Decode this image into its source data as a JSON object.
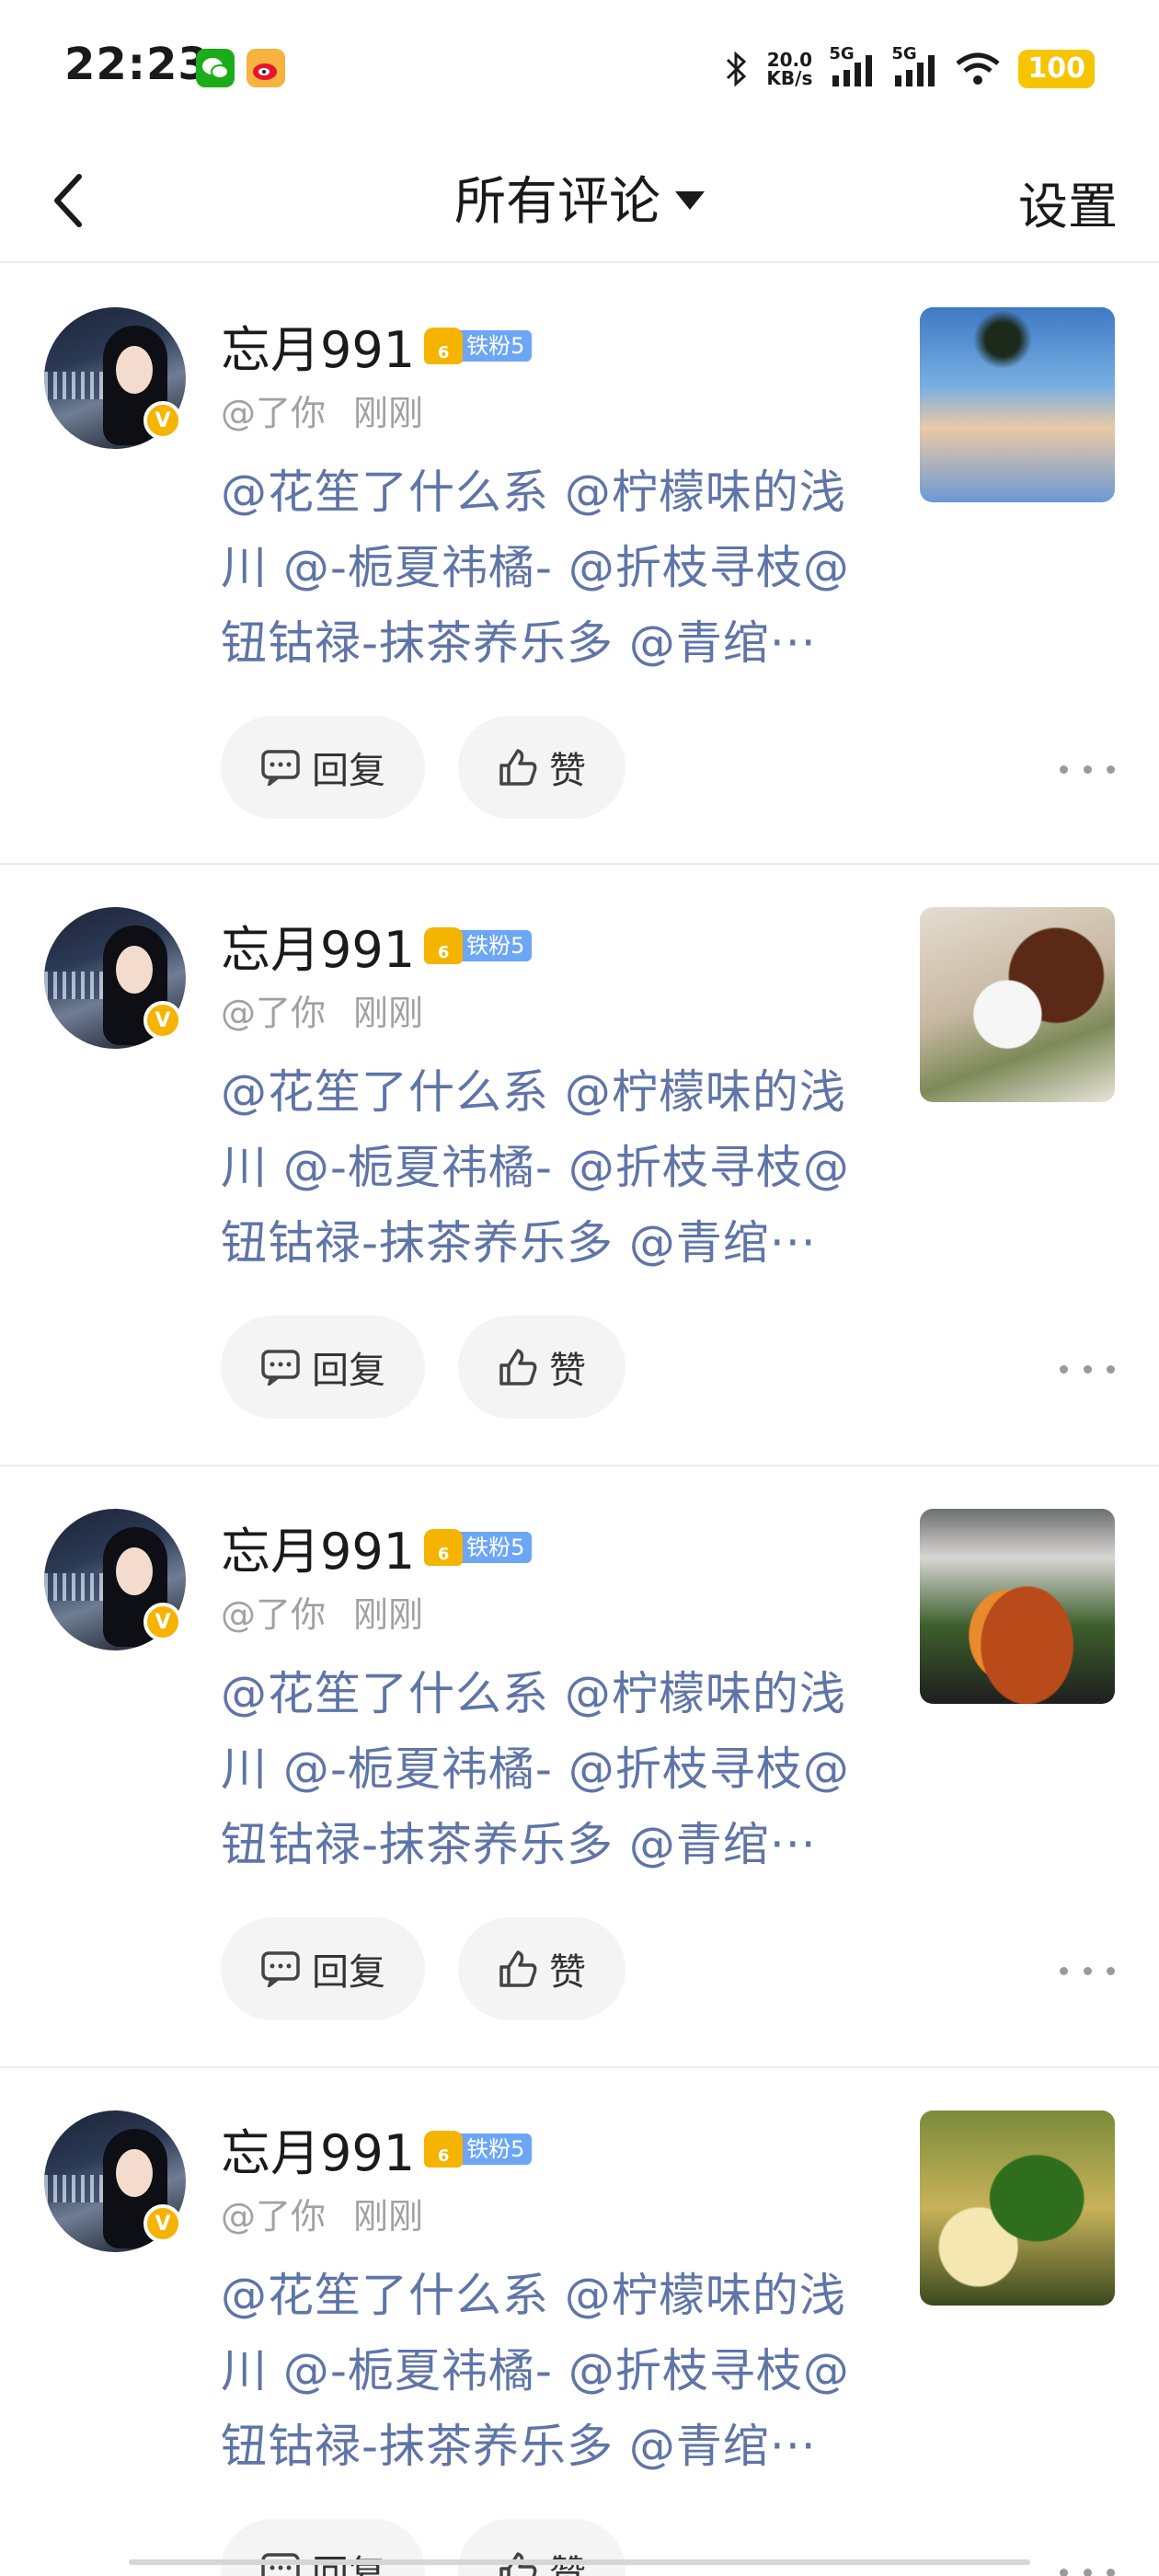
{
  "status_bar": {
    "time": "22:23",
    "net_speed_value": "20.0",
    "net_speed_unit": "KB/s",
    "sim1": "5G",
    "sim2": "5G",
    "battery": "100"
  },
  "header": {
    "title": "所有评论",
    "settings_label": "设置"
  },
  "comments": [
    {
      "username": "忘月991",
      "fan_badge": "铁粉5",
      "fan_level": "6",
      "handle": "@了你",
      "time": "刚刚",
      "content_lines": [
        "@花笙了什么系 @柠檬味的浅",
        "川 @-栀夏祎橘- @折枝寻枝@",
        "钮钴禄-抹茶养乐多 @青绾···"
      ],
      "reply_label": "回复",
      "like_label": "赞",
      "thumb": "sky"
    },
    {
      "username": "忘月991",
      "fan_badge": "铁粉5",
      "fan_level": "6",
      "handle": "@了你",
      "time": "刚刚",
      "content_lines": [
        "@花笙了什么系 @柠檬味的浅",
        "川 @-栀夏祎橘- @折枝寻枝@",
        "钮钴禄-抹茶养乐多 @青绾···"
      ],
      "reply_label": "回复",
      "like_label": "赞",
      "thumb": "dessert"
    },
    {
      "username": "忘月991",
      "fan_badge": "铁粉5",
      "fan_level": "6",
      "handle": "@了你",
      "time": "刚刚",
      "content_lines": [
        "@花笙了什么系 @柠檬味的浅",
        "川 @-栀夏祎橘- @折枝寻枝@",
        "钮钴禄-抹茶养乐多 @青绾···"
      ],
      "reply_label": "回复",
      "like_label": "赞",
      "thumb": "salad"
    },
    {
      "username": "忘月991",
      "fan_badge": "铁粉5",
      "fan_level": "6",
      "handle": "@了你",
      "time": "刚刚",
      "content_lines": [
        "@花笙了什么系 @柠檬味的浅",
        "川 @-栀夏祎橘- @折枝寻枝@",
        "钮钴禄-抹茶养乐多 @青绾···"
      ],
      "reply_label": "回复",
      "like_label": "赞",
      "thumb": "soup"
    }
  ],
  "colors": {
    "mention_blue": "#5f75a7",
    "fan_badge_blue": "#6ca6f5",
    "crown_gold": "#f5b400",
    "verified_gold": "#f6b400",
    "battery_yellow": "#f6c400"
  },
  "icons": {
    "back": "chevron-left-icon",
    "dropdown": "caret-down-icon",
    "reply": "comment-icon",
    "like": "thumbs-up-icon",
    "more": "more-horizontal-icon"
  }
}
